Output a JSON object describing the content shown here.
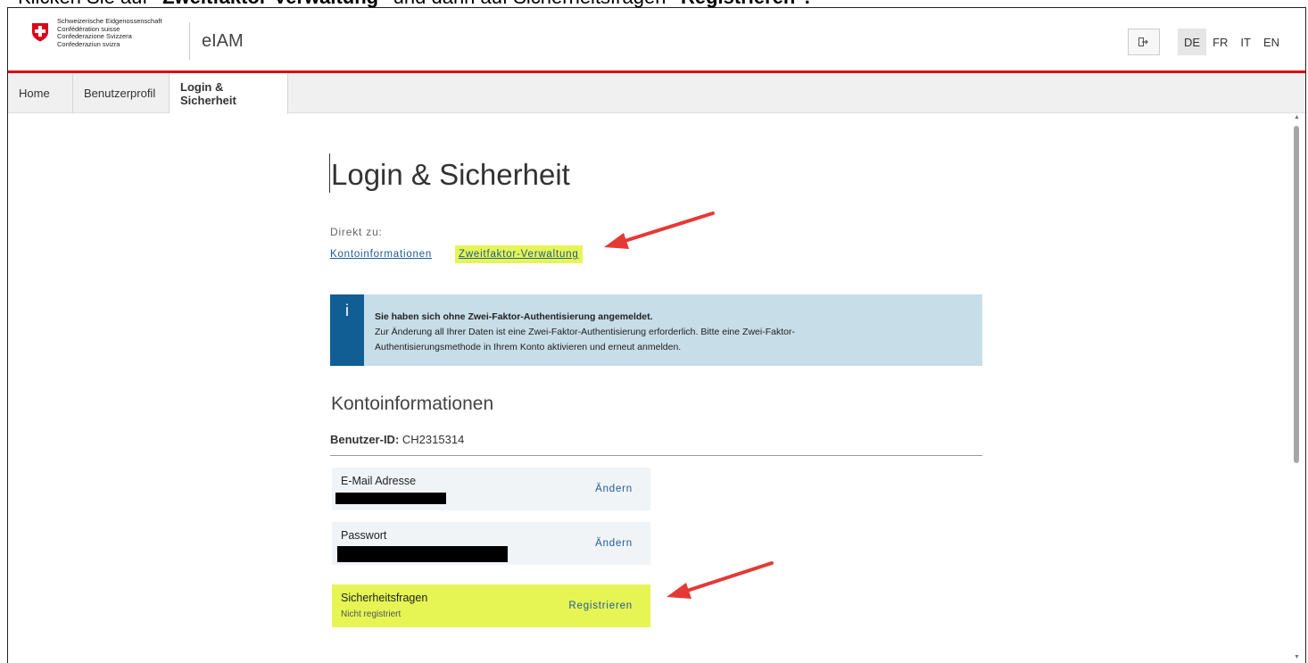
{
  "instruction": {
    "part1": "Klicken Sie auf ",
    "part2": "\"Zweitfaktor-Verwaltung\"",
    "part3": " und dann auf Sicherheitsfragen ",
    "part4": "\"Registrieren\"."
  },
  "header": {
    "federal_lines": [
      "Schweizerische Eidgenossenschaft",
      "Confédération suisse",
      "Confederazione Svizzera",
      "Confederaziun svizra"
    ],
    "brand": "eIAM",
    "logout_icon": "logout-icon",
    "languages": [
      "DE",
      "FR",
      "IT",
      "EN"
    ],
    "active_language": "DE"
  },
  "nav": {
    "items": [
      {
        "label": "Home"
      },
      {
        "label": "Benutzerprofil"
      },
      {
        "label": "Login & Sicherheit"
      }
    ],
    "active": "Login & Sicherheit"
  },
  "main": {
    "title": "Login & Sicherheit",
    "direct_label": "Direkt zu:",
    "links": {
      "konto": "Kontoinformationen",
      "zwei": "Zweitfaktor-Verwaltung"
    },
    "info": {
      "icon_glyph": "i",
      "bold": "Sie haben sich ohne Zwei-Faktor-Authentisierung angemeldet.",
      "line1": "Zur Änderung all Ihrer Daten ist eine Zwei-Faktor-Authentisierung erforderlich. Bitte eine Zwei-Faktor-",
      "line2": "Authentisierungsmethode in Ihrem Konto aktivieren und erneut anmelden."
    },
    "section_title": "Kontoinformationen",
    "userid_label": "Benutzer-ID:",
    "userid_value": "CH2315314",
    "cards": {
      "email": {
        "label": "E-Mail Adresse",
        "action": "Ändern"
      },
      "password": {
        "label": "Passwort",
        "action": "Ändern"
      },
      "security": {
        "label": "Sicherheitsfragen",
        "status": "Nicht registriert",
        "action": "Registrieren"
      }
    }
  },
  "colors": {
    "swiss_red": "#dc0018",
    "highlight": "#e6f554",
    "link_blue": "#1e5a96",
    "info_bg": "#c7dde8",
    "info_stripe": "#105e93",
    "arrow_red": "#e53935"
  }
}
